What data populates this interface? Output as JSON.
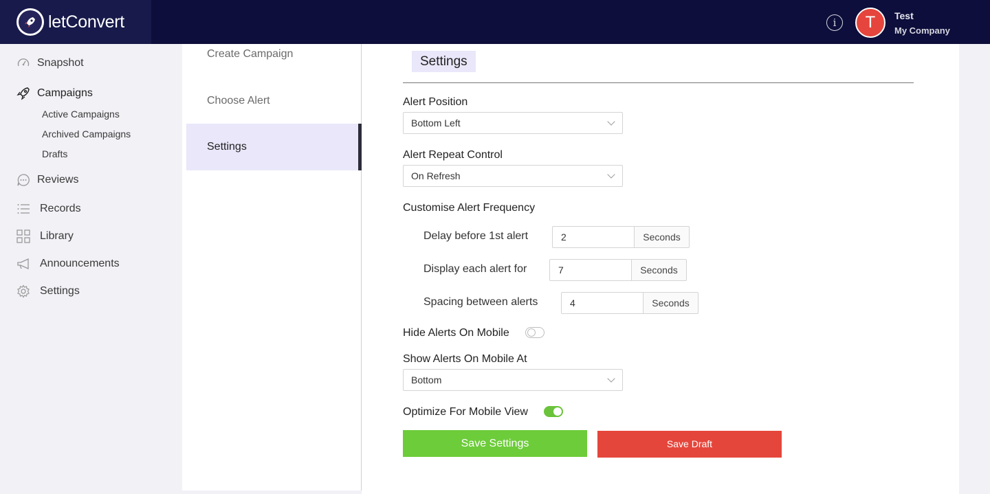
{
  "app": {
    "logo_prefix": "let",
    "logo_suffix": "Convert"
  },
  "user": {
    "initial": "T",
    "name": "Test",
    "company": "My Company"
  },
  "sidebar": {
    "items": [
      {
        "label": "Snapshot",
        "icon": "speedometer-icon"
      },
      {
        "label": "Campaigns",
        "icon": "rocket-icon"
      },
      {
        "label": "Reviews",
        "icon": "chat-bubble-icon"
      },
      {
        "label": "Records",
        "icon": "list-icon"
      },
      {
        "label": "Library",
        "icon": "grid-icon"
      },
      {
        "label": "Announcements",
        "icon": "megaphone-icon"
      },
      {
        "label": "Settings",
        "icon": "gear-icon"
      }
    ],
    "sub_items": [
      "Active Campaigns",
      "Archived Campaigns",
      "Drafts"
    ]
  },
  "steps": {
    "create": "Create Campaign",
    "choose": "Choose Alert",
    "settings": "Settings",
    "active": "Settings"
  },
  "settings": {
    "title": "Settings",
    "alert_position": {
      "label": "Alert Position",
      "value": "Bottom Left"
    },
    "repeat_control": {
      "label": "Alert Repeat Control",
      "value": "On Refresh"
    },
    "frequency": {
      "label": "Customise Alert Frequency",
      "delay": {
        "label": "Delay before 1st alert",
        "value": "2",
        "unit": "Seconds"
      },
      "display": {
        "label": "Display each alert for",
        "value": "7",
        "unit": "Seconds"
      },
      "spacing": {
        "label": "Spacing between alerts",
        "value": "4",
        "unit": "Seconds"
      }
    },
    "hide_mobile": {
      "label": "Hide Alerts On Mobile",
      "on": false
    },
    "mobile_position": {
      "label": "Show Alerts On Mobile At",
      "value": "Bottom"
    },
    "optimize_mobile": {
      "label": "Optimize For Mobile View",
      "on": true
    },
    "save_label": "Save Settings",
    "draft_label": "Save Draft"
  },
  "colors": {
    "topbar": "#0d0e3b",
    "accent_active": "#e9e7f9",
    "save": "#6dcc3a",
    "draft": "#e5463b",
    "avatar": "#e5453c"
  }
}
